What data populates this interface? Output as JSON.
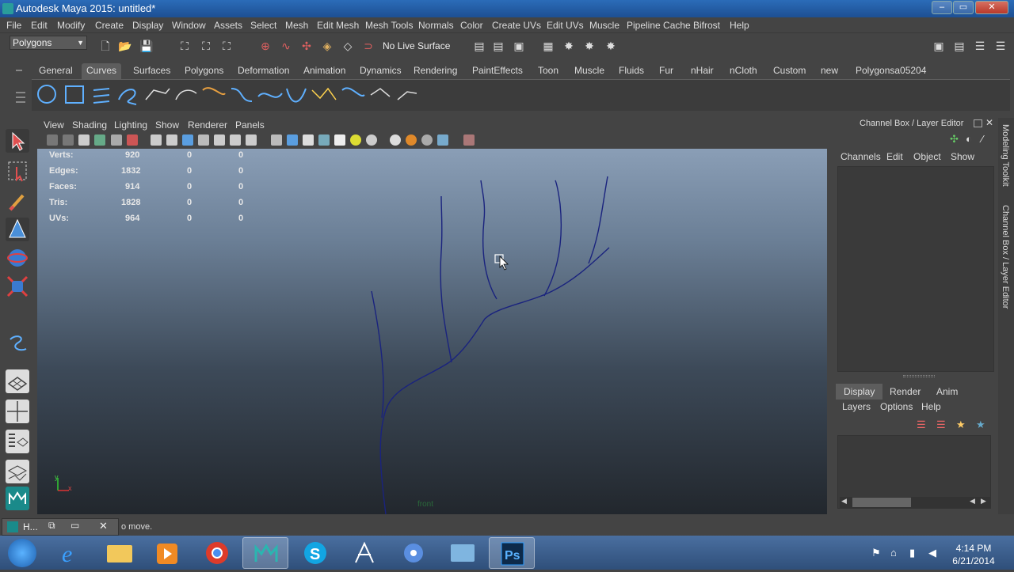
{
  "window": {
    "title": "Autodesk Maya 2015: untitled*",
    "controls": [
      "–",
      "▭",
      "✕"
    ]
  },
  "menubar": {
    "items": [
      "File",
      "Edit",
      "Modify",
      "Create",
      "Display",
      "Window",
      "Assets",
      "Select",
      "Mesh",
      "Edit Mesh",
      "Mesh Tools",
      "Normals",
      "Color",
      "Create UVs",
      "Edit UVs",
      "Muscle",
      "Pipeline Cache",
      "Bifrost",
      "Help"
    ]
  },
  "statusline": {
    "mode": "Polygons",
    "live_surface": "No Live Surface"
  },
  "shelf": {
    "tabs": [
      "General",
      "Curves",
      "Surfaces",
      "Polygons",
      "Deformation",
      "Animation",
      "Dynamics",
      "Rendering",
      "PaintEffects",
      "Toon",
      "Muscle",
      "Fluids",
      "Fur",
      "nHair",
      "nCloth",
      "Custom",
      "new",
      "Polygonsa05204"
    ],
    "active_tab": "Curves"
  },
  "viewport": {
    "menus": [
      "View",
      "Shading",
      "Lighting",
      "Show",
      "Renderer",
      "Panels"
    ],
    "hud": [
      {
        "label": "Verts:",
        "v1": "920",
        "v2": "0",
        "v3": "0"
      },
      {
        "label": "Edges:",
        "v1": "1832",
        "v2": "0",
        "v3": "0"
      },
      {
        "label": "Faces:",
        "v1": "914",
        "v2": "0",
        "v3": "0"
      },
      {
        "label": "Tris:",
        "v1": "1828",
        "v2": "0",
        "v3": "0"
      },
      {
        "label": "UVs:",
        "v1": "964",
        "v2": "0",
        "v3": "0"
      }
    ],
    "camera_label": "front",
    "axis_y": "y",
    "axis_x": "x",
    "curve_color": "#1a237e"
  },
  "channelbox": {
    "title": "Channel Box / Layer Editor",
    "menus": [
      "Channels",
      "Edit",
      "Object",
      "Show"
    ],
    "layer_tabs": [
      "Display",
      "Render",
      "Anim"
    ],
    "layer_menus": [
      "Layers",
      "Options",
      "Help"
    ],
    "side_tabs": [
      "Modeling Toolkit",
      "Channel Box / Layer Editor"
    ]
  },
  "helpline": {
    "minimized_label": "H...",
    "text": "o move."
  },
  "taskbar": {
    "time": "4:14 PM",
    "date": "6/21/2014"
  }
}
